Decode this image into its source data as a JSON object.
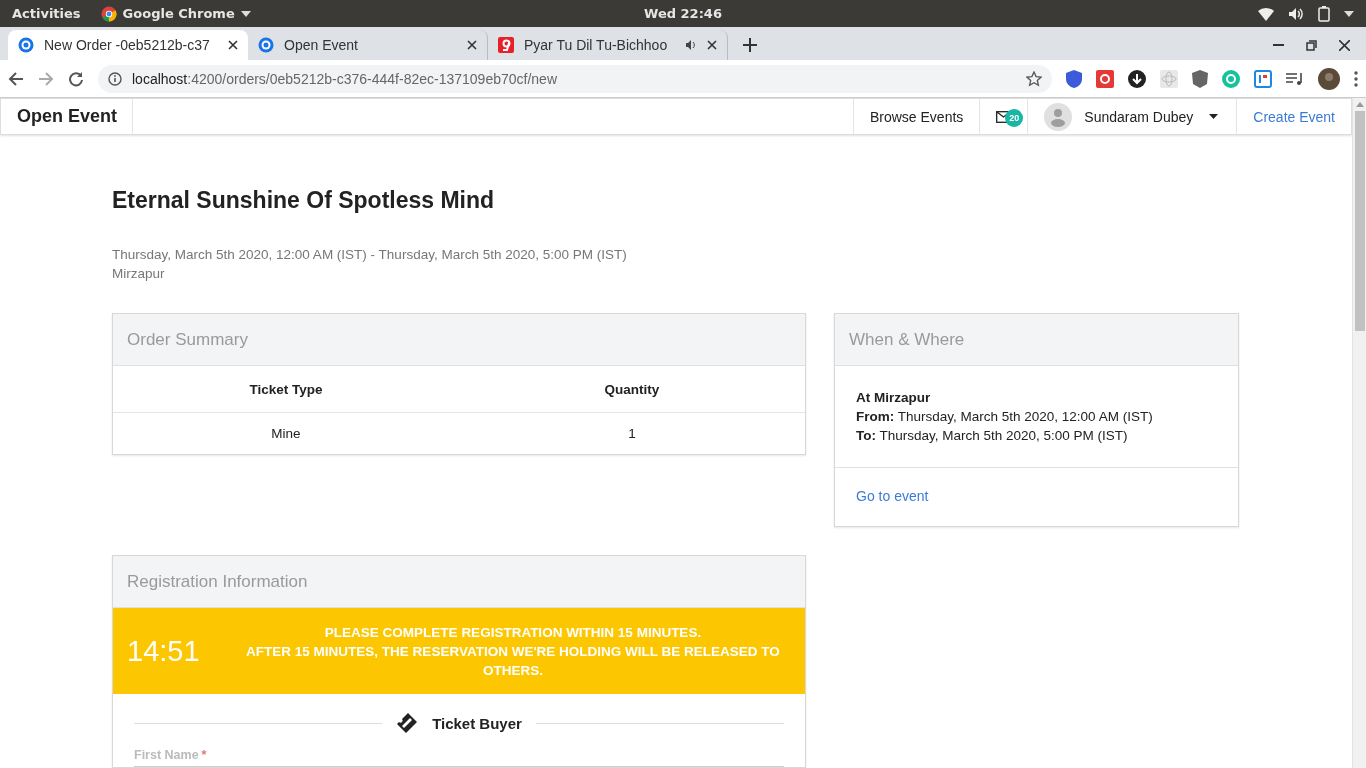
{
  "os_bar": {
    "activities": "Activities",
    "app": "Google Chrome",
    "clock": "Wed 22:46"
  },
  "browser": {
    "tabs": [
      {
        "title": "New Order -0eb5212b-c37",
        "selected": true,
        "kind": "page"
      },
      {
        "title": "Open Event",
        "selected": false,
        "kind": "page"
      },
      {
        "title": "Pyar Tu Dil Tu-Bichhoo",
        "selected": false,
        "kind": "audio"
      }
    ],
    "url_host": "localhost",
    "url_path": ":4200/orders/0eb5212b-c376-444f-82ec-137109eb70cf/new"
  },
  "navbar": {
    "brand": "Open Event",
    "browse": "Browse Events",
    "badge": "20",
    "user": "Sundaram Dubey",
    "create": "Create Event"
  },
  "event": {
    "title": "Eternal Sunshine Of Spotless Mind",
    "dates": "Thursday, March 5th 2020, 12:00 AM (IST) - Thursday, March 5th 2020, 5:00 PM (IST)",
    "location": "Mirzapur"
  },
  "order_summary": {
    "title": "Order Summary",
    "columns": [
      "Ticket Type",
      "Quantity"
    ],
    "rows": [
      [
        "Mine",
        "1"
      ]
    ]
  },
  "when_where": {
    "title": "When & Where",
    "place": "At Mirzapur",
    "from": "**From:** Thursday, March 5th 2020, 12:00 AM (IST)",
    "to": "**To:** Thursday, March 5th 2020, 5:00 PM (IST)",
    "link": "Go to event"
  },
  "registration": {
    "title": "Registration Information",
    "timer": "14:51",
    "notice": [
      "PLEASE COMPLETE REGISTRATION WITHIN 15 MINUTES.",
      "AFTER 15 MINUTES, THE RESERVATION WE'RE HOLDING WILL BE RELEASED TO OTHERS."
    ],
    "section": "Ticket Buyer",
    "fields": [
      {
        "label": "First Name",
        "required_mark": "*"
      }
    ]
  }
}
